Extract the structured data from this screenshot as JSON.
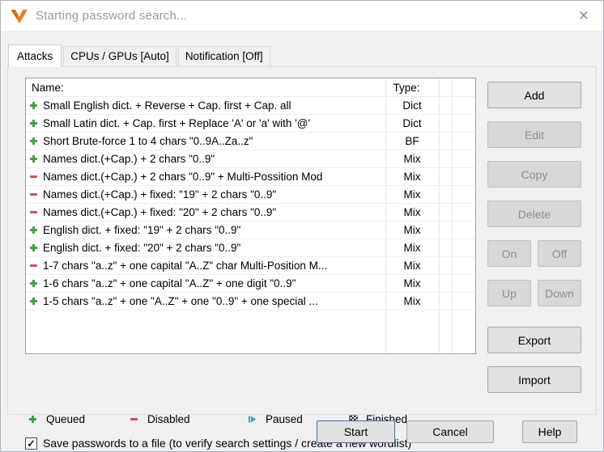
{
  "window": {
    "title": "Starting password search...",
    "close_icon": "×"
  },
  "tabs": [
    {
      "label": "Attacks",
      "active": true
    },
    {
      "label": "CPUs / GPUs [Auto]",
      "active": false
    },
    {
      "label": "Notification [Off]",
      "active": false
    }
  ],
  "attack_list": {
    "columns": {
      "name": "Name:",
      "type": "Type:"
    },
    "rows": [
      {
        "status": "queued",
        "name": "Small English dict. + Reverse + Cap. first + Cap. all",
        "type": "Dict"
      },
      {
        "status": "queued",
        "name": "Small Latin dict. + Cap. first + Replace 'A' or 'a' with '@'",
        "type": "Dict"
      },
      {
        "status": "queued",
        "name": "Short Brute-force 1 to 4 chars \"0..9A..Za..z\"",
        "type": "BF"
      },
      {
        "status": "queued",
        "name": "Names dict.(+Cap.) + 2 chars \"0..9\"",
        "type": "Mix"
      },
      {
        "status": "disabled",
        "name": "Names dict.(+Cap.) + 2 chars \"0..9\" + Multi-Possition Mod",
        "type": "Mix"
      },
      {
        "status": "disabled",
        "name": "Names dict.(+Cap.) + fixed: \"19\" + 2 chars \"0..9\"",
        "type": "Mix"
      },
      {
        "status": "disabled",
        "name": "Names dict.(+Cap.) + fixed: \"20\" + 2 chars \"0..9\"",
        "type": "Mix"
      },
      {
        "status": "queued",
        "name": "English dict. + fixed: \"19\" + 2 chars \"0..9\"",
        "type": "Mix"
      },
      {
        "status": "queued",
        "name": "English dict. + fixed: \"20\" + 2 chars \"0..9\"",
        "type": "Mix"
      },
      {
        "status": "disabled",
        "name": "1-7 chars \"a..z\" + one capital \"A..Z\" char Multi-Position M...",
        "type": "Mix"
      },
      {
        "status": "queued",
        "name": "1-6 chars \"a..z\" + one capital \"A..Z\" + one digit \"0..9\"",
        "type": "Mix"
      },
      {
        "status": "queued",
        "name": "1-5 chars \"a..z\" + one \"A..Z\" + one \"0..9\" + one special ...",
        "type": "Mix"
      }
    ]
  },
  "legend": [
    {
      "icon": "queued-icon",
      "label": "Queued"
    },
    {
      "icon": "disabled-icon",
      "label": "Disabled"
    },
    {
      "icon": "paused-icon",
      "label": "Paused"
    },
    {
      "icon": "finished-icon",
      "label": "Finished"
    }
  ],
  "save_checkbox": {
    "checked": true,
    "check_glyph": "✓",
    "label": "Save passwords to a file (to verify search settings / create a new wordlist)"
  },
  "side_buttons": {
    "add": "Add",
    "edit": "Edit",
    "copy": "Copy",
    "delete": "Delete",
    "on": "On",
    "off": "Off",
    "up": "Up",
    "down": "Down",
    "export": "Export",
    "import": "Import"
  },
  "bottom_buttons": {
    "start": "Start",
    "cancel": "Cancel",
    "help": "Help"
  },
  "colors": {
    "queued_green": "#3fa33f",
    "disabled_red": "#d14f4f",
    "paused_blue": "#3f9fb8",
    "logo_orange": "#ef7f1a",
    "start_border_blue": "#3c71a6"
  }
}
